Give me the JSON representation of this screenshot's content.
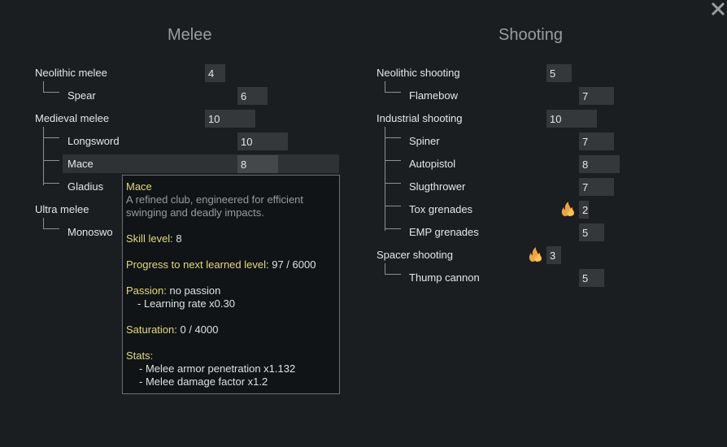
{
  "columns": {
    "melee_title": "Melee",
    "shooting_title": "Shooting"
  },
  "melee": [
    {
      "name": "Neolithic melee",
      "value": "4"
    },
    {
      "name": "Spear",
      "value": "6"
    },
    {
      "name": "Medieval melee",
      "value": "10"
    },
    {
      "name": "Longsword",
      "value": "10"
    },
    {
      "name": "Mace",
      "value": "8"
    },
    {
      "name": "Gladius",
      "value": ""
    },
    {
      "name": "Ultra melee",
      "value": ""
    },
    {
      "name": "Monoswo",
      "value": ""
    }
  ],
  "shooting": [
    {
      "name": "Neolithic shooting",
      "value": "5"
    },
    {
      "name": "Flamebow",
      "value": "7"
    },
    {
      "name": "Industrial shooting",
      "value": "10"
    },
    {
      "name": "Spiner",
      "value": "7"
    },
    {
      "name": "Autopistol",
      "value": "8"
    },
    {
      "name": "Slugthrower",
      "value": "7"
    },
    {
      "name": "Tox grenades",
      "value": "2"
    },
    {
      "name": "EMP grenades",
      "value": "5"
    },
    {
      "name": "Spacer shooting",
      "value": "3"
    },
    {
      "name": "Thump cannon",
      "value": "5"
    }
  ],
  "icons": {
    "close": "close-icon",
    "passion": "flame-icon",
    "passion_color": "#f2a33a"
  },
  "tooltip": {
    "title": "Mace",
    "desc_line1": "A refined club, engineered for efficient",
    "desc_line2": "swinging and deadly impacts.",
    "skill_label": "Skill level:",
    "skill_value": " 8",
    "progress_label": "Progress to next learned level:",
    "progress_value": " 97 / 6000",
    "passion_label": "Passion:",
    "passion_value": " no passion",
    "learning_rate": "- Learning rate x0.30",
    "saturation_label": "Saturation:",
    "saturation_value": " 0 / 4000",
    "stats_label": "Stats:",
    "stat1": "- Melee armor penetration x1.132",
    "stat2": "- Melee damage factor x1.2"
  }
}
